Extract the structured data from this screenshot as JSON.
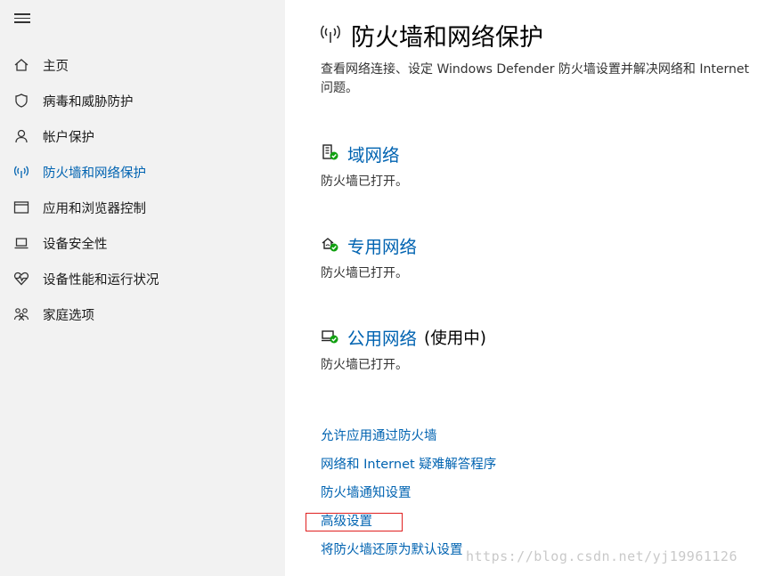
{
  "sidebar": {
    "items": [
      {
        "label": "主页",
        "icon": "home-icon"
      },
      {
        "label": "病毒和威胁防护",
        "icon": "shield-icon"
      },
      {
        "label": "帐户保护",
        "icon": "person-icon"
      },
      {
        "label": "防火墙和网络保护",
        "icon": "wireless-icon",
        "active": true
      },
      {
        "label": "应用和浏览器控制",
        "icon": "app-window-icon"
      },
      {
        "label": "设备安全性",
        "icon": "laptop-icon"
      },
      {
        "label": "设备性能和运行状况",
        "icon": "heart-pulse-icon"
      },
      {
        "label": "家庭选项",
        "icon": "family-icon"
      }
    ]
  },
  "main": {
    "title": "防火墙和网络保护",
    "subtitle": "查看网络连接、设定 Windows Defender 防火墙设置并解决网络和 Internet 问题。",
    "networks": [
      {
        "name": "域网络",
        "status": "防火墙已打开。",
        "icon": "domain-network-icon"
      },
      {
        "name": "专用网络",
        "status": "防火墙已打开。",
        "icon": "private-network-icon"
      },
      {
        "name": "公用网络",
        "in_use": "(使用中)",
        "status": "防火墙已打开。",
        "icon": "public-network-icon"
      }
    ],
    "links": [
      "允许应用通过防火墙",
      "网络和 Internet 疑难解答程序",
      "防火墙通知设置",
      "高级设置",
      "将防火墙还原为默认设置"
    ]
  },
  "watermark": "https://blog.csdn.net/yj19961126",
  "colors": {
    "accent": "#0063b1",
    "sidebar_bg": "#f2f2f2",
    "status_ok": "#10a010",
    "highlight": "#e02020"
  }
}
